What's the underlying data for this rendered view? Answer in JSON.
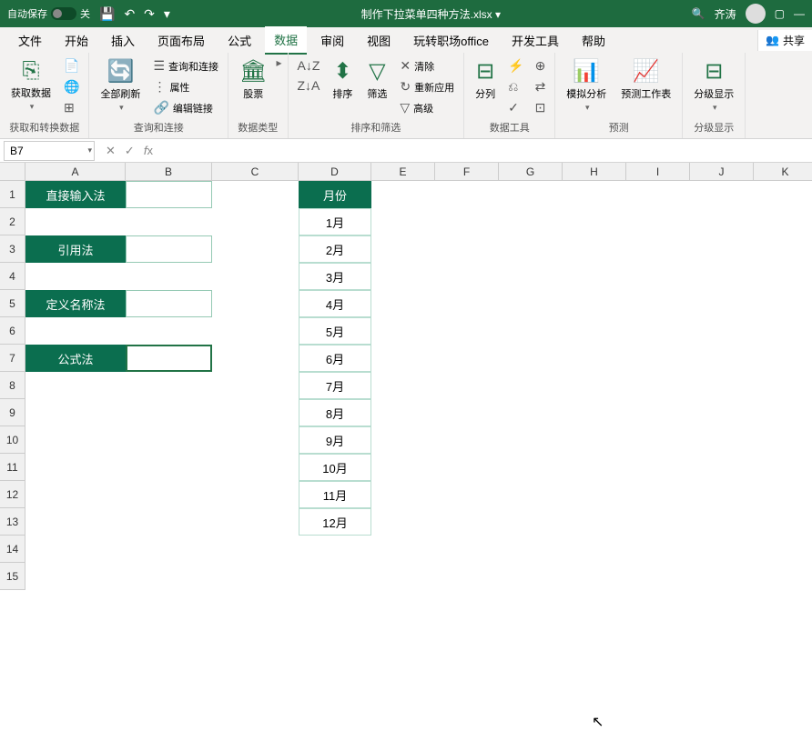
{
  "titlebar": {
    "autosave": "自动保存",
    "off": "关",
    "filename": "制作下拉菜单四种方法.xlsx ▾",
    "search_icon": "🔍",
    "username": "齐涛"
  },
  "tabs": {
    "file": "文件",
    "home": "开始",
    "insert": "插入",
    "page_layout": "页面布局",
    "formulas": "公式",
    "data": "数据",
    "review": "审阅",
    "view": "视图",
    "wps": "玩转职场office",
    "developer": "开发工具",
    "help": "帮助",
    "share": "共享"
  },
  "ribbon": {
    "get_data": "获取数据",
    "get_transform": "获取和转换数据",
    "refresh_all": "全部刷新",
    "queries_conn": "查询和连接",
    "properties": "属性",
    "edit_links": "编辑链接",
    "queries_label": "查询和连接",
    "stocks": "股票",
    "data_types": "数据类型",
    "sort": "排序",
    "sort_filter": "排序和筛选",
    "filter": "筛选",
    "clear": "清除",
    "reapply": "重新应用",
    "advanced": "高级",
    "text_to_col": "分列",
    "data_tools": "数据工具",
    "whatif": "模拟分析",
    "forecast": "预测工作表",
    "forecast_label": "预测",
    "group": "分级显示",
    "group_label": "分级显示"
  },
  "namebox": {
    "value": "B7"
  },
  "columns": [
    "A",
    "B",
    "C",
    "D",
    "E",
    "F",
    "G",
    "H",
    "I",
    "J",
    "K"
  ],
  "rows": [
    "1",
    "2",
    "3",
    "4",
    "5",
    "6",
    "7",
    "8",
    "9",
    "10",
    "11",
    "12",
    "13",
    "14",
    "15"
  ],
  "spreadsheet": {
    "a1": "直接输入法",
    "a3": "引用法",
    "a5": "定义名称法",
    "a7": "公式法",
    "d1": "月份",
    "d2": "1月",
    "d3": "2月",
    "d4": "3月",
    "d5": "4月",
    "d6": "5月",
    "d7": "6月",
    "d8": "7月",
    "d9": "8月",
    "d10": "9月",
    "d11": "10月",
    "d12": "11月",
    "d13": "12月"
  },
  "chart_data": null
}
